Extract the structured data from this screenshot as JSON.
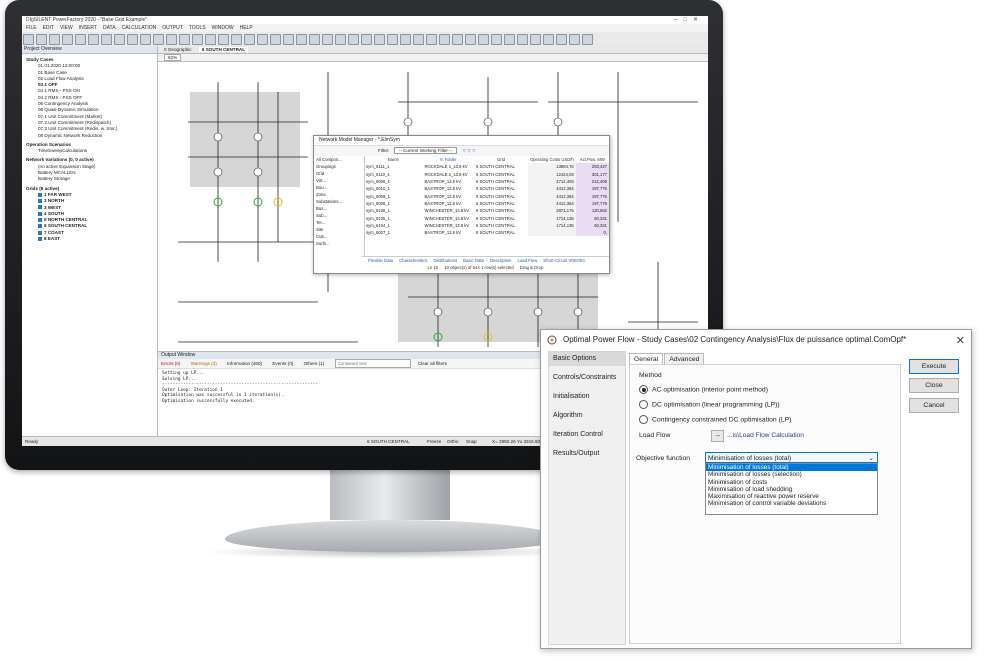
{
  "app": {
    "window_title": "DIgSILENT PowerFactory 2020 - \"Base Grid Example\"",
    "menu": [
      "FILE",
      "EDIT",
      "VIEW",
      "INSERT",
      "DATA",
      "CALCULATION",
      "OUTPUT",
      "TOOLS",
      "WINDOW",
      "HELP"
    ]
  },
  "project_overview": {
    "header": "Project Overview",
    "study_cases_title": "Study Cases",
    "study_cases": [
      {
        "label": "01.01.2020 12:00:00",
        "bold": false
      },
      {
        "label": "01 Base Case",
        "bold": false
      },
      {
        "label": "02 Load Flow Analysis",
        "bold": false
      },
      {
        "label": "03.1 OFF",
        "bold": true
      },
      {
        "label": "04.1 RMS - PSS ON",
        "bold": false
      },
      {
        "label": "04.2 RMS - PSS OFF",
        "bold": false
      },
      {
        "label": "05 Contingency Analysis",
        "bold": false
      },
      {
        "label": "06 Quasi-Dynamic Simulation",
        "bold": false
      },
      {
        "label": "07.1 Unit Commitment (Market)",
        "bold": false
      },
      {
        "label": "07.2 Unit Commitment (Redispatch)",
        "bold": false
      },
      {
        "label": "07.3 Unit Commitment (Redis. w. Stor.)",
        "bold": false
      },
      {
        "label": "08 Dynamic Network Reduction",
        "bold": false
      }
    ],
    "operation_scenarios_title": "Operation Scenarios",
    "operation_scenarios": [
      "TimeSweepCalculations"
    ],
    "network_variations_title": "Network Variations (0, 0 active)",
    "network_variations": [
      "(no active Expansion Stage)",
      "Battery MCALLEN",
      "Battery Storage"
    ],
    "grids_title": "Grids (8 active)",
    "grids": [
      "1 FAR WEST",
      "2 NORTH",
      "3 WEST",
      "4 SOUTH",
      "5 NORTH CENTRAL",
      "6 SOUTH CENTRAL",
      "7 COAST",
      "8 EAST"
    ]
  },
  "diagram_tabs": [
    "0 Geographic",
    "6 SOUTH CENTRAL"
  ],
  "zoom": "62%",
  "network_model_manager": {
    "title": "Network Model Manager - *.ElmSym",
    "filter_label": "Filter:",
    "filter_value": "-- Current Working Filter --",
    "tree": [
      "All Compon...",
      "Groupings",
      "Grid",
      "Virt...",
      "Bou...",
      "Zone",
      "Substations...",
      "Bus...",
      "Sub...",
      "Ter...",
      "Site",
      "Cub...",
      "Surfs..."
    ],
    "columns": [
      "Name",
      "In Folder",
      "Grid",
      "Operating Costs USD/h",
      "Act.Pow. MW"
    ],
    "rows": [
      {
        "name": "sym_6111_1",
        "folder": "ROCKDALE 1_13.8 kV",
        "grid": "6 SOUTH CENTRAL",
        "cost": "13884,76",
        "pw": "293,427"
      },
      {
        "name": "sym_6110_1",
        "folder": "ROCKDALE 1_13.8 kV",
        "grid": "6 SOUTH CENTRAL",
        "cost": "12424,03",
        "pw": "301,177"
      },
      {
        "name": "sym_6006_1",
        "folder": "BASTROP_13.8 kV",
        "grid": "6 SOUTH CENTRAL",
        "cost": "4712,403",
        "pw": "212,405"
      },
      {
        "name": "sym_6010_1",
        "folder": "BASTROP_13.8 kV",
        "grid": "6 SOUTH CENTRAL",
        "cost": "4412,364",
        "pw": "197,776"
      },
      {
        "name": "sym_6009_1",
        "folder": "BASTROP_13.8 kV",
        "grid": "6 SOUTH CENTRAL",
        "cost": "4412,364",
        "pw": "197,776"
      },
      {
        "name": "sym_6008_1",
        "folder": "BASTROP_13.8 kV",
        "grid": "6 SOUTH CENTRAL",
        "cost": "4412,364",
        "pw": "197,776"
      },
      {
        "name": "sym_6106_1",
        "folder": "WINCHESTER_13.8 kV",
        "grid": "6 SOUTH CENTRAL",
        "cost": "2871,175",
        "pw": "120,662"
      },
      {
        "name": "sym_6105_1",
        "folder": "WINCHESTER_13.8 kV",
        "grid": "6 SOUTH CENTRAL",
        "cost": "1714,135",
        "pw": "60,331"
      },
      {
        "name": "sym_6104_1",
        "folder": "WINCHESTER_13.8 kV",
        "grid": "6 SOUTH CENTRAL",
        "cost": "1714,135",
        "pw": "60,331"
      },
      {
        "name": "sym_6007_1",
        "folder": "BASTROP_13.8 kV",
        "grid": "6 SOUTH CENTRAL",
        "cost": "",
        "pw": "0,"
      }
    ],
    "footer_tabs": [
      "Flexible Data",
      "Characteristics",
      "Distributions",
      "Basic Data",
      "Description",
      "Load Flow",
      "Short-Circuit VDE/IEC"
    ],
    "status": "Ln 10",
    "selection": "10 object(s) of 544   1 row(s) selected",
    "drag": "Drag & Drop"
  },
  "output_window": {
    "header": "Output Window",
    "filters": [
      "Errors (0)",
      "Warnings (3)",
      "Information (460)",
      "Events (0)",
      "Others (1)"
    ],
    "search_placeholder": "Contained text",
    "clear_label": "Clear all filters",
    "lines": "Setting up LP...\nSolving LP...\n-----------------------------------------------------------\nOuter Loop: Iteration 1\nOptimisation was successful in 1 iteration(s).\nOptimisation successfully executed."
  },
  "status_bar": {
    "left": "Ready",
    "grid": "6 SOUTH CENTRAL",
    "freeze": "Freeze",
    "ortho": "Ortho",
    "snap": "Snap",
    "coords": "X= 2850.26 Yu 3316.50"
  },
  "opf_dialog": {
    "title": "Optimal Power Flow - Study Cases\\02 Contingency Analysis\\Flux de puissance optimal.ComOpf*",
    "nav": [
      "Basic Options",
      "Controls/Constraints",
      "Initialisation",
      "Algorithm",
      "Iteration Control",
      "Results/Output"
    ],
    "tabs": [
      "General",
      "Advanced"
    ],
    "method_label": "Method",
    "methods": [
      {
        "label": "AC optimisation (interior point method)",
        "selected": true
      },
      {
        "label": "DC optimisation (linear programming (LP))",
        "selected": false
      },
      {
        "label": "Contingency constrained DC optimisation (LP)",
        "selected": false
      }
    ],
    "load_flow_label": "Load Flow",
    "load_flow_link": "...is\\Load Flow Calculation",
    "objective_label": "Objective function",
    "objective_value": "Minimisation of losses (total)",
    "objective_options": [
      "Minimisation of losses (total)",
      "Minimisation of losses (selection)",
      "Minimisation of costs",
      "Minimisation of load shedding",
      "Maximisation of reactive power reserve",
      "Minimisation of control variable deviations"
    ],
    "buttons": {
      "execute": "Execute",
      "close": "Close",
      "cancel": "Cancel"
    }
  }
}
